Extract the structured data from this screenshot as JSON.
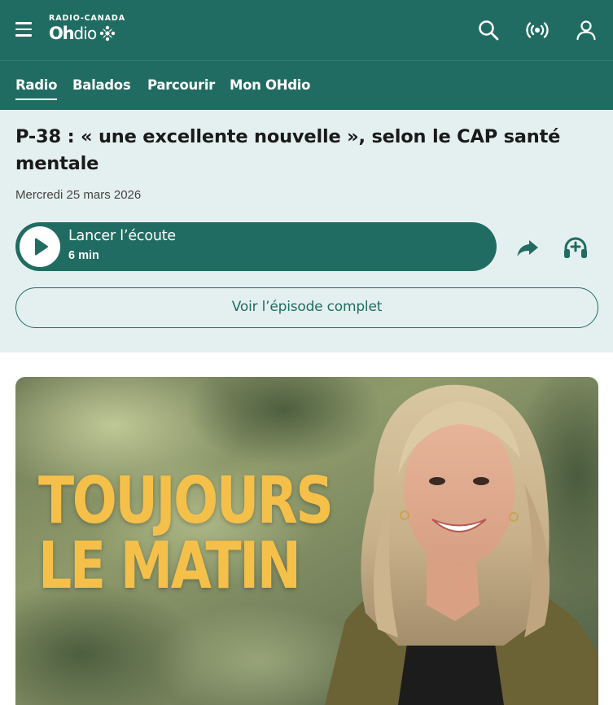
{
  "header": {
    "brand_top": "RADIO-CANADA",
    "brand_oh": "Oh",
    "brand_dio": "dio"
  },
  "nav": {
    "tabs": [
      {
        "label": "Radio",
        "active": true
      },
      {
        "label": "Balados",
        "active": false
      },
      {
        "label": "Parcourir",
        "active": false
      },
      {
        "label": "Mon OHdio",
        "active": false
      }
    ]
  },
  "episode": {
    "title": "P-38 : « une excellente nouvelle », selon le CAP santé mentale",
    "date": "Mercredi 25 mars 2026",
    "play_label": "Lancer l’écoute",
    "duration": "6 min",
    "full_episode_label": "Voir l’épisode complet"
  },
  "cover": {
    "title_line1": "TOUJOURS",
    "title_line2": "LE MATIN"
  },
  "colors": {
    "brand_green": "#216c62",
    "panel_bg": "#e4f0ef",
    "cover_title": "#f5c04a"
  },
  "icons": [
    "menu-icon",
    "ohdio-gem-icon",
    "search-icon",
    "live-radio-icon",
    "user-icon",
    "play-icon",
    "share-icon",
    "add-podcast-icon"
  ]
}
